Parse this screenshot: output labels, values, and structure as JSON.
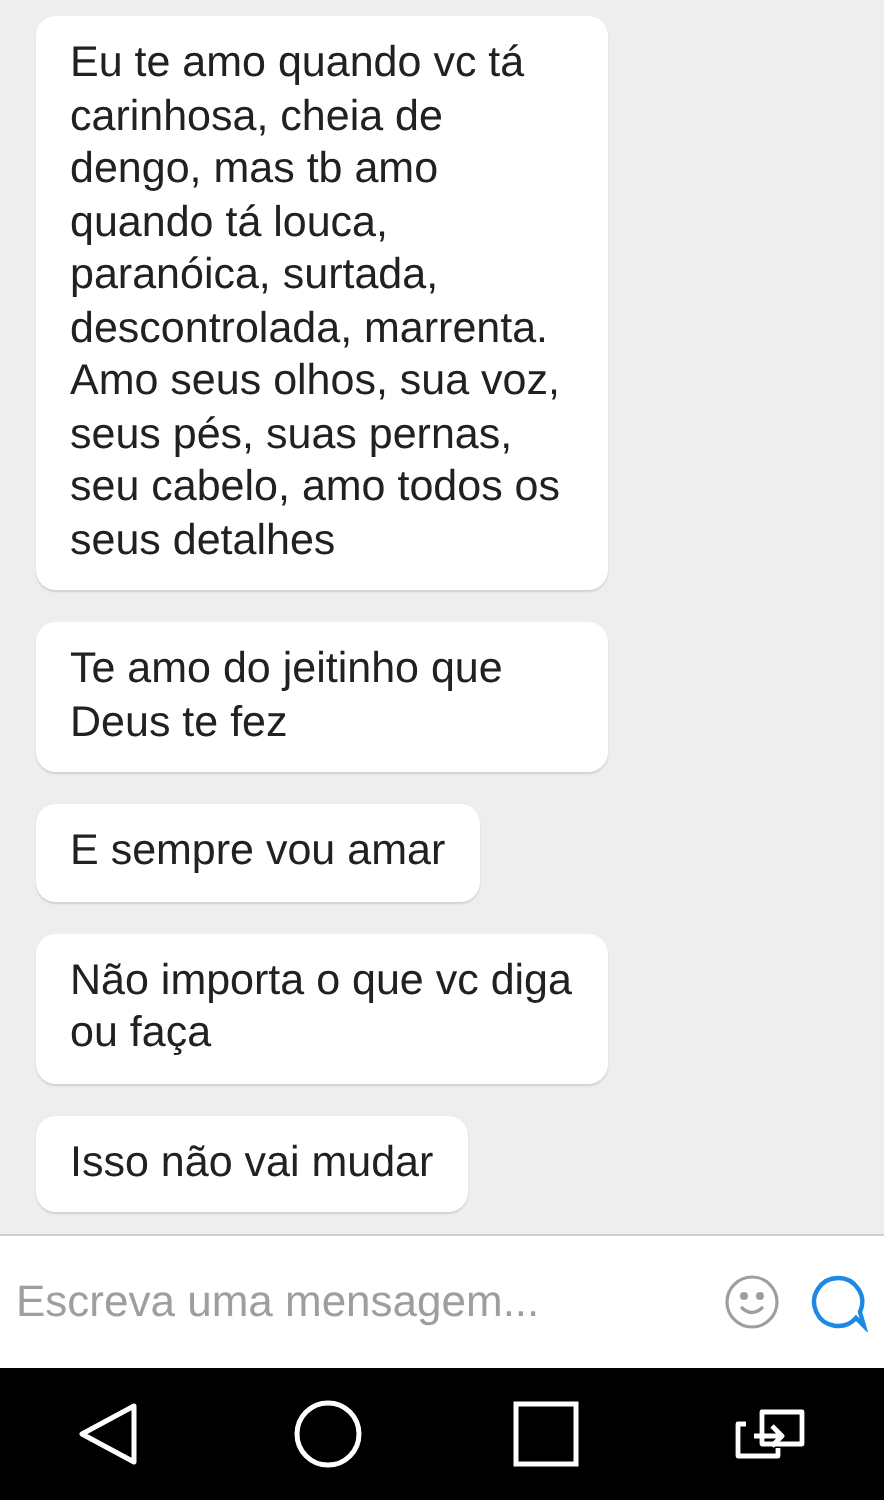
{
  "messages": [
    {
      "text": "Eu te amo quando vc tá carinhosa, cheia de dengo, mas tb amo quando tá louca, paranóica, surtada, descontrolada, marrenta. Amo seus olhos, sua voz, seus pés, suas pernas, seu cabelo, amo todos os seus detalhes"
    },
    {
      "text": "Te amo do jeitinho que Deus te fez"
    },
    {
      "text": "E sempre vou amar"
    },
    {
      "text": "Não importa o que vc diga ou faça"
    },
    {
      "text": "Isso não vai mudar"
    }
  ],
  "composer": {
    "placeholder": "Escreva uma mensagem..."
  }
}
